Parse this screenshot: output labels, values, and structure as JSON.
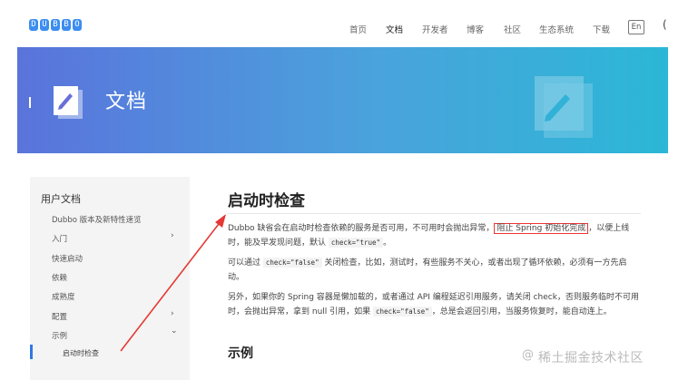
{
  "header": {
    "logo_letters": [
      "D",
      "U",
      "B",
      "B",
      "O"
    ],
    "nav": [
      "首页",
      "文档",
      "开发者",
      "博客",
      "社区",
      "生态系统",
      "下载"
    ],
    "active_nav": "文档",
    "lang_button": "En",
    "extra_glyph": "("
  },
  "banner": {
    "title": "文档",
    "gradient_start": "#5a73dc",
    "gradient_end": "#2bb7d6",
    "icon": "document-pencil-icon"
  },
  "sidebar": {
    "title": "用户文档",
    "items": [
      {
        "label": "Dubbo 版本及新特性速览",
        "chevron": ""
      },
      {
        "label": "入门",
        "chevron": "›"
      },
      {
        "label": "快速启动",
        "chevron": ""
      },
      {
        "label": "依赖",
        "chevron": ""
      },
      {
        "label": "成熟度",
        "chevron": ""
      },
      {
        "label": "配置",
        "chevron": "›"
      },
      {
        "label": "示例",
        "chevron": "⌄"
      }
    ],
    "active_item": "启动时检查",
    "accent_color": "#2f7ae5"
  },
  "content": {
    "title": "启动时检查",
    "p1_before": "Dubbo 缺省会在启动时检查依赖的服务是否可用，不可用时会抛出异常，",
    "p1_highlight": "阻止 Spring 初始化完成",
    "p1_after": "，以便上线时，能及早发现问题，默认",
    "p1_code": "check=\"true\"",
    "p1_end": "。",
    "p2_before": "可以通过",
    "p2_code": "check=\"false\"",
    "p2_after": "关闭检查，比如，测试时，有些服务不关心，或者出现了循环依赖，必须有一方先启动。",
    "p3_before": "另外，如果你的 Spring 容器是懒加载的，或者通过 API 编程延迟引用服务，请关闭 check，否则服务临时不可用时，会抛出异常，拿到 null 引用，如果",
    "p3_code": "check=\"false\"",
    "p3_after": "，总是会返回引用，当服务恢复时，能自动连上。",
    "section_title": "示例"
  },
  "annotation": {
    "arrow_color": "#e53935",
    "highlight_color": "#e33333"
  },
  "watermark": {
    "at": "@",
    "text": "稀土掘金技术社区"
  }
}
